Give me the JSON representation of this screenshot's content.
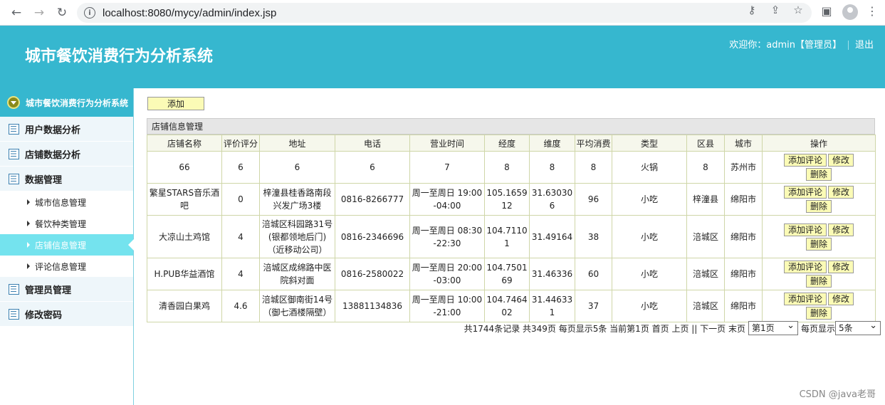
{
  "browser": {
    "url": "localhost:8080/mycy/admin/index.jsp"
  },
  "header": {
    "title": "城市餐饮消费行为分析系统",
    "welcome": "欢迎你：admin【管理员】",
    "logout": "退出"
  },
  "sidebar": {
    "top": "城市餐饮消费行为分析系统",
    "groups": [
      {
        "label": "用户数据分析"
      },
      {
        "label": "店铺数据分析"
      },
      {
        "label": "数据管理"
      },
      {
        "label": "管理员管理"
      },
      {
        "label": "修改密码"
      }
    ],
    "subitems": [
      {
        "label": "城市信息管理"
      },
      {
        "label": "餐饮种类管理"
      },
      {
        "label": "店铺信息管理"
      },
      {
        "label": "评论信息管理"
      }
    ]
  },
  "main": {
    "add_label": "添加",
    "panel_title": "店铺信息管理",
    "columns": [
      "店铺名称",
      "评价评分",
      "地址",
      "电话",
      "营业时间",
      "经度",
      "维度",
      "平均消费",
      "类型",
      "区县",
      "城市",
      "操作"
    ],
    "rows": [
      [
        "66",
        "6",
        "6",
        "6",
        "7",
        "8",
        "8",
        "8",
        "火锅",
        "8",
        "苏州市"
      ],
      [
        "繁星STARS音乐酒吧",
        "0",
        "梓潼县桂香路南段兴发广场3楼",
        "0816-8266777",
        "周一至周日 19:00-04:00",
        "105.165912",
        "31.630306",
        "96",
        "小吃",
        "梓潼县",
        "绵阳市"
      ],
      [
        "大凉山土鸡馆",
        "4",
        "涪城区科园路31号(银都领地后门)（近移动公司）",
        "0816-2346696",
        "周一至周日 08:30-22:30",
        "104.71101",
        "31.49164",
        "38",
        "小吃",
        "涪城区",
        "绵阳市"
      ],
      [
        "H.PUB华益酒馆",
        "4",
        "涪城区成绵路中医院斜对面",
        "0816-2580022",
        "周一至周日 20:00-03:00",
        "104.750169",
        "31.46336",
        "60",
        "小吃",
        "涪城区",
        "绵阳市"
      ],
      [
        "清香园白果鸡",
        "4.6",
        "涪城区御南街14号（御七酒楼隔壁）",
        "13881134836",
        "周一至周日 10:00-21:00",
        "104.746402",
        "31.446331",
        "37",
        "小吃",
        "涪城区",
        "绵阳市"
      ]
    ],
    "ops": {
      "comment": "添加评论",
      "edit": "修改",
      "delete": "删除"
    },
    "pager": {
      "summary": "共1744条记录 共349页 每页显示5条 当前第1页 首页 上页 || 下一页 末页",
      "page_select": "第1页",
      "per_page_label": "每页显示",
      "per_page_select": "5条"
    }
  },
  "watermark": "CSDN @java老哥"
}
